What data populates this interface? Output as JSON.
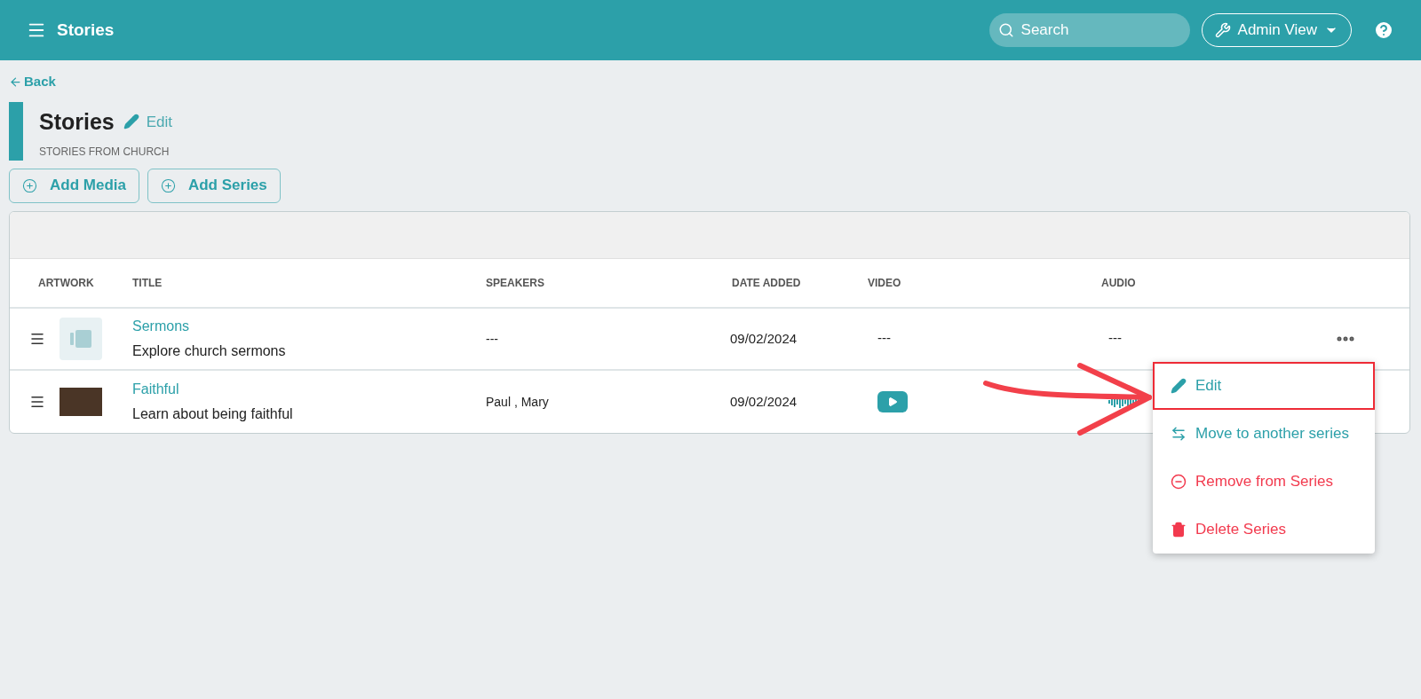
{
  "header": {
    "title": "Stories",
    "search": {
      "placeholder": "Search"
    },
    "view_button": "Admin View"
  },
  "back_link": "Back",
  "page": {
    "title": "Stories",
    "edit_link": "Edit",
    "subtitle": "STORIES FROM CHURCH"
  },
  "actions": [
    "Add Media",
    "Add Series"
  ],
  "table": {
    "columns": [
      "ARTWORK",
      "TITLE",
      "SPEAKERS",
      "DATE ADDED",
      "VIDEO",
      "AUDIO"
    ],
    "rows": [
      {
        "artwork": {
          "kind": "placeholder"
        },
        "title": "Sermons",
        "description": "Explore church sermons",
        "speakers": "---",
        "date_added": "09/02/2024",
        "video": {
          "kind": "text",
          "text": "---"
        },
        "audio": {
          "kind": "text",
          "text": "---"
        },
        "more_menu": true
      },
      {
        "artwork": {
          "kind": "photo"
        },
        "title": "Faithful",
        "description": "Learn about being faithful",
        "speakers": "Paul , Mary",
        "date_added": "09/02/2024",
        "video": {
          "kind": "icon"
        },
        "audio": {
          "kind": "icon"
        },
        "more_menu": false
      }
    ]
  },
  "menu": {
    "items": [
      {
        "kind": "edit",
        "label": "Edit",
        "color": "#2ca0a9",
        "annotated": true
      },
      {
        "kind": "move",
        "label": "Move to another series",
        "color": "#2ca0a9",
        "annotated": false
      },
      {
        "kind": "remove",
        "label": "Remove from Series",
        "color": "#f23a4e",
        "annotated": false
      },
      {
        "kind": "delete",
        "label": "Delete Series",
        "color": "#f23a4e",
        "annotated": false
      }
    ]
  }
}
